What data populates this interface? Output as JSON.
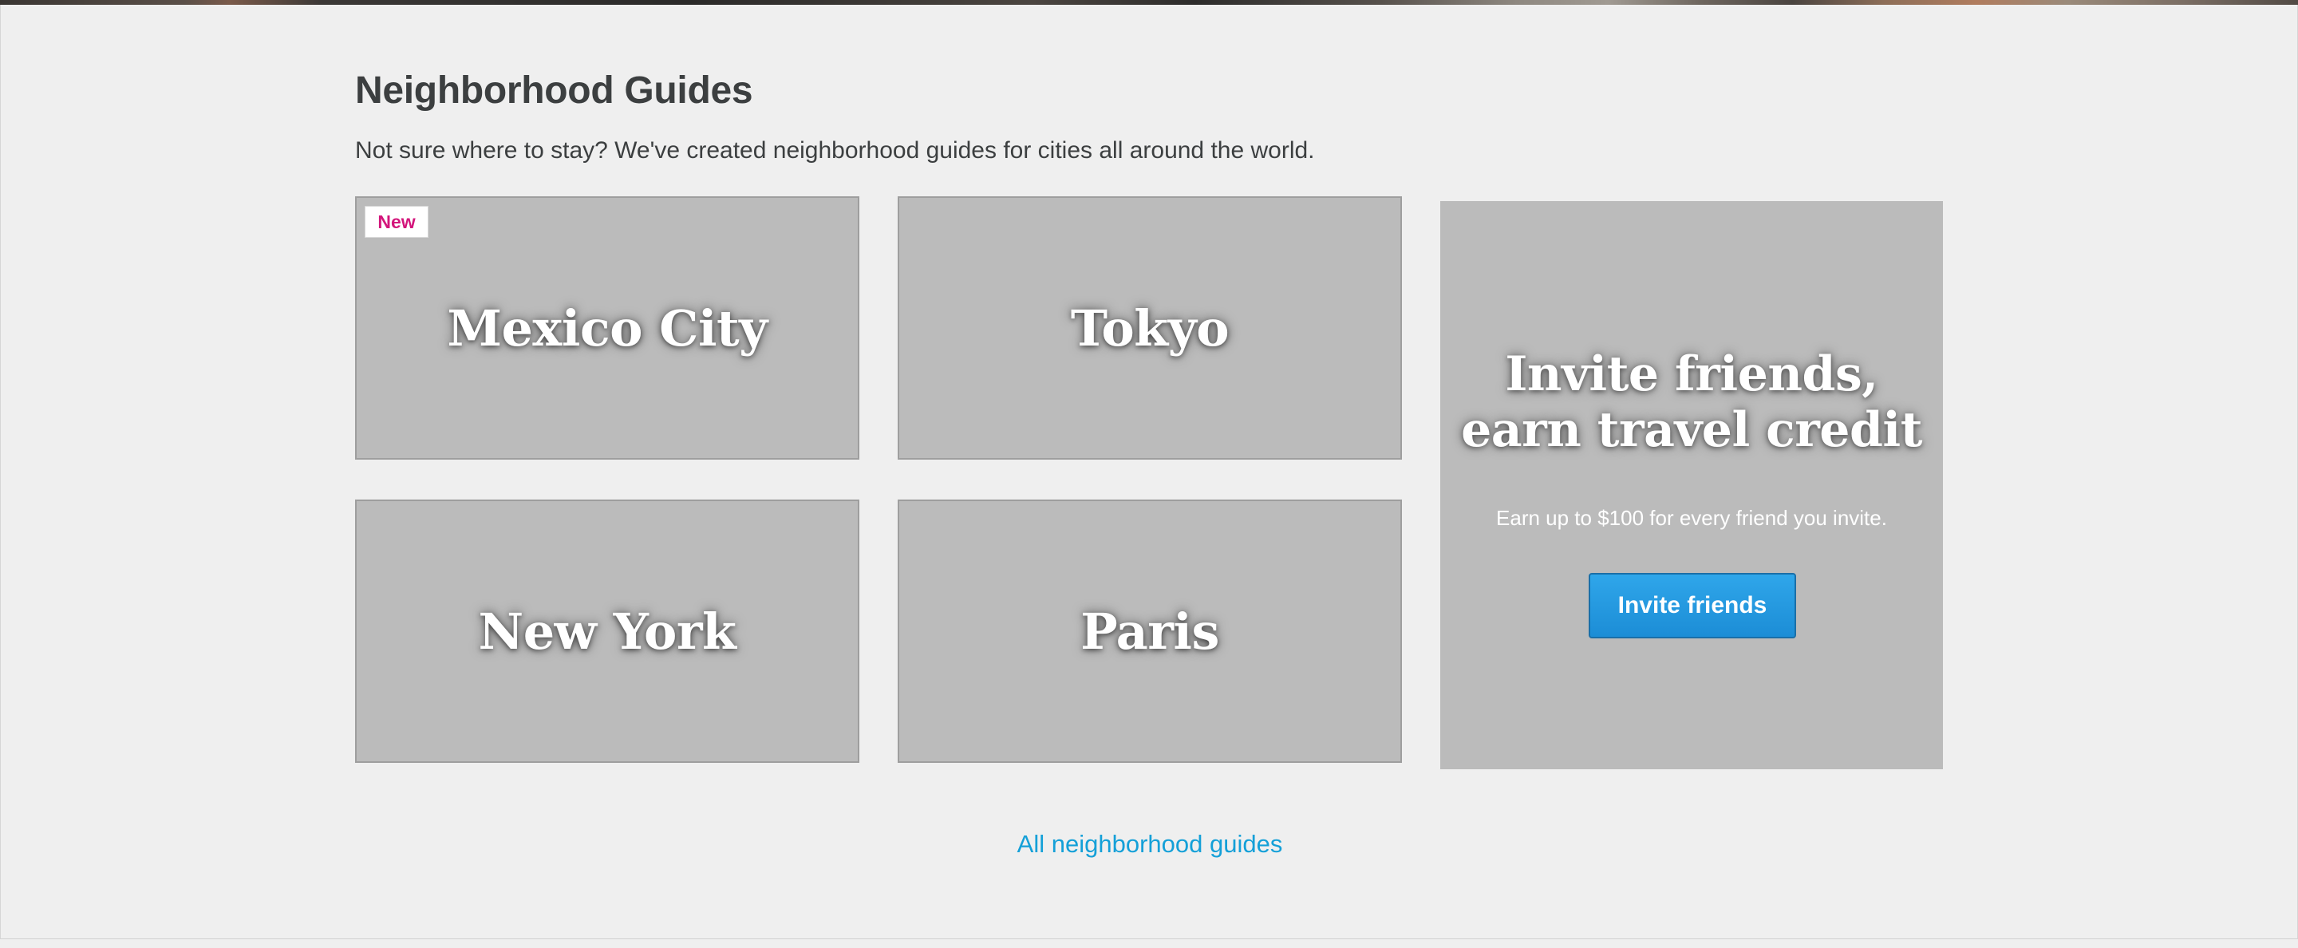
{
  "header": {
    "title": "Neighborhood Guides",
    "subtitle": "Not sure where to stay? We've created neighborhood guides for cities all around the world."
  },
  "guides": [
    {
      "name": "Mexico City",
      "badge": "New"
    },
    {
      "name": "Tokyo"
    },
    {
      "name": "New York"
    },
    {
      "name": "Paris"
    }
  ],
  "invite": {
    "title_line1": "Invite friends,",
    "title_line2": "earn travel credit",
    "text": "Earn up to $100 for every friend you invite.",
    "button_label": "Invite friends",
    "button_color": "#1f95dc"
  },
  "footer": {
    "link_label": "All neighborhood guides",
    "link_color": "#14a0d8"
  },
  "colors": {
    "badge_text": "#d3157b",
    "card_background": "#bbbbbb",
    "page_background": "#efefef"
  }
}
